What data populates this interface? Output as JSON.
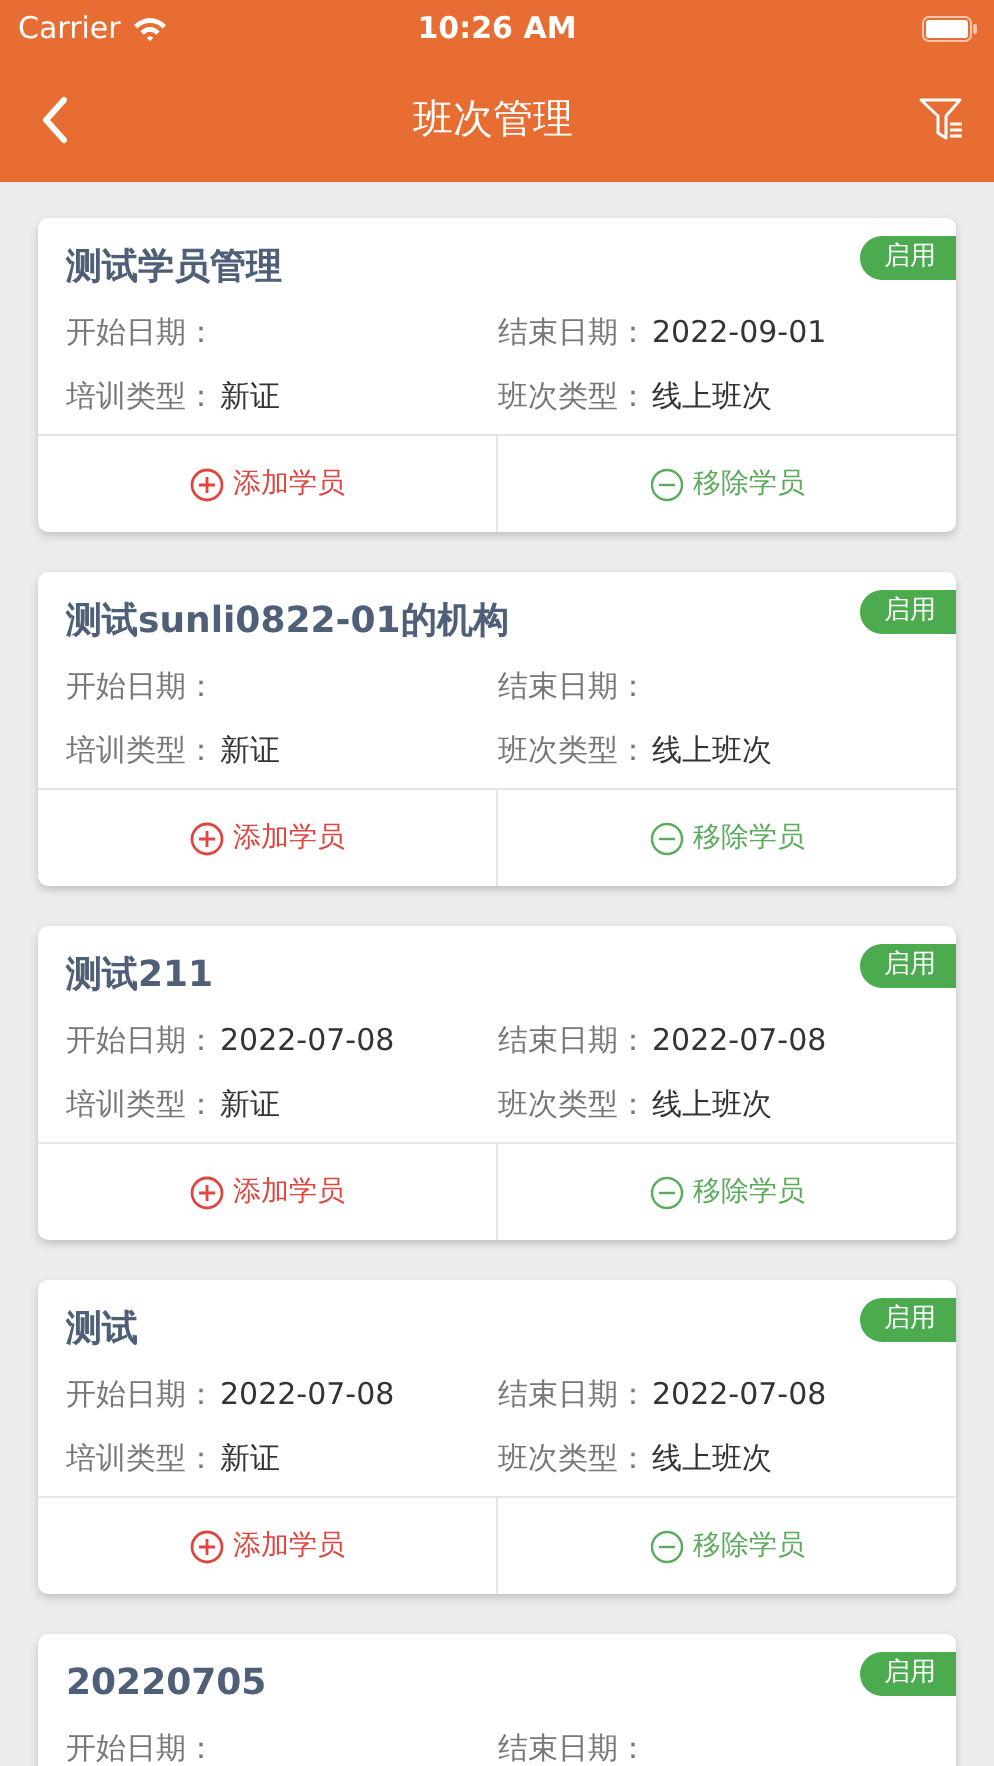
{
  "status_bar": {
    "carrier": "Carrier",
    "time": "10:26 AM"
  },
  "nav": {
    "title": "班次管理"
  },
  "cards": [
    {
      "title": "测试学员管理",
      "status": {
        "label": "启用",
        "kind": "enabled"
      },
      "fields": [
        {
          "label": "开始日期："
        },
        {
          "label": "结束日期：",
          "value": "2022-09-01"
        },
        {
          "label": "培训类型：",
          "value": "新证"
        },
        {
          "label": "班次类型：",
          "value": "线上班次"
        }
      ],
      "actions": [
        {
          "label": "添加学员",
          "kind": "add"
        },
        {
          "label": "移除学员",
          "kind": "remove"
        }
      ]
    },
    {
      "title": "测试sunli0822-01的机构",
      "status": {
        "label": "启用",
        "kind": "enabled"
      },
      "fields": [
        {
          "label": "开始日期："
        },
        {
          "label": "结束日期："
        },
        {
          "label": "培训类型：",
          "value": "新证"
        },
        {
          "label": "班次类型：",
          "value": "线上班次"
        }
      ],
      "actions": [
        {
          "label": "添加学员",
          "kind": "add"
        },
        {
          "label": "移除学员",
          "kind": "remove"
        }
      ]
    },
    {
      "title": "测试211",
      "status": {
        "label": "启用",
        "kind": "enabled"
      },
      "fields": [
        {
          "label": "开始日期：",
          "value": "2022-07-08"
        },
        {
          "label": "结束日期：",
          "value": "2022-07-08"
        },
        {
          "label": "培训类型：",
          "value": "新证"
        },
        {
          "label": "班次类型：",
          "value": "线上班次"
        }
      ],
      "actions": [
        {
          "label": "添加学员",
          "kind": "add"
        },
        {
          "label": "移除学员",
          "kind": "remove"
        }
      ]
    },
    {
      "title": "测试",
      "status": {
        "label": "启用",
        "kind": "enabled"
      },
      "fields": [
        {
          "label": "开始日期：",
          "value": "2022-07-08"
        },
        {
          "label": "结束日期：",
          "value": "2022-07-08"
        },
        {
          "label": "培训类型：",
          "value": "新证"
        },
        {
          "label": "班次类型：",
          "value": "线上班次"
        }
      ],
      "actions": [
        {
          "label": "添加学员",
          "kind": "add"
        },
        {
          "label": "移除学员",
          "kind": "remove"
        }
      ]
    },
    {
      "title": "20220705",
      "status": {
        "label": "启用",
        "kind": "enabled"
      },
      "fields": [
        {
          "label": "开始日期："
        },
        {
          "label": "结束日期："
        }
      ]
    }
  ]
}
